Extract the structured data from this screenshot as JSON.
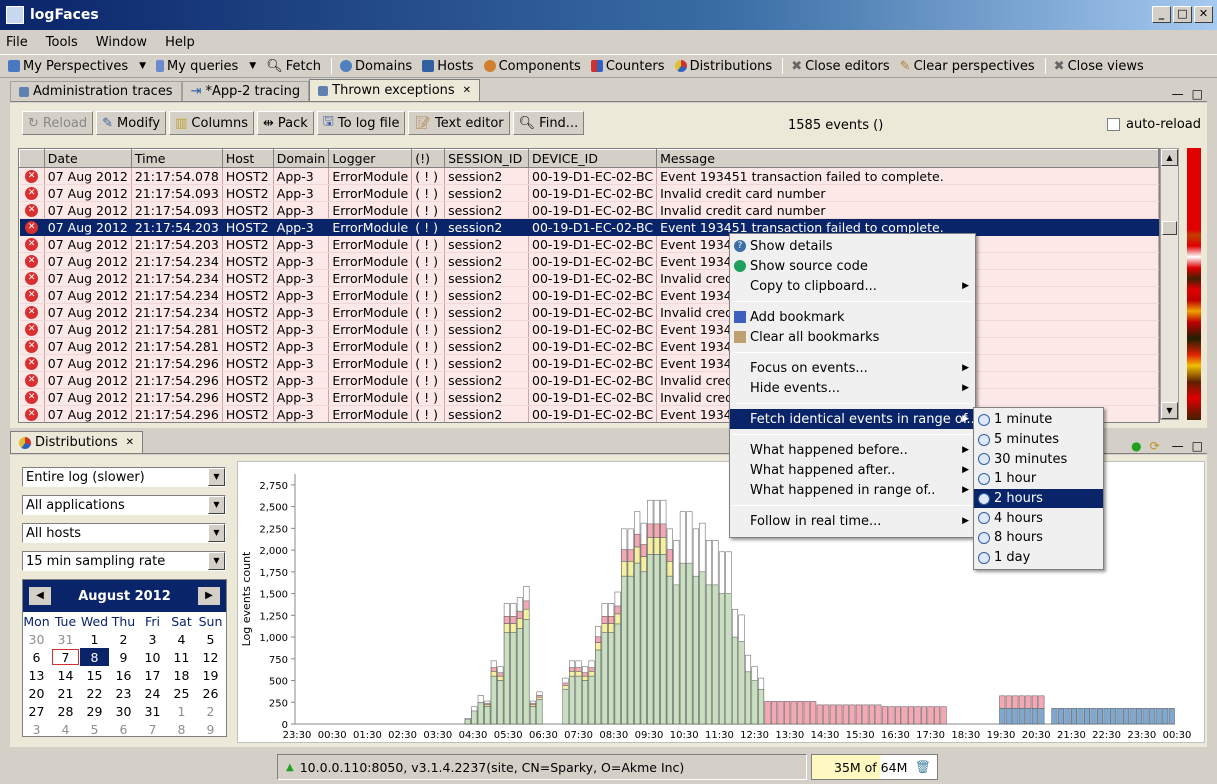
{
  "window": {
    "title": "logFaces"
  },
  "menu": [
    "File",
    "Tools",
    "Window",
    "Help"
  ],
  "toolbar": {
    "my_perspectives": "My Perspectives",
    "my_queries": "My queries",
    "fetch": "Fetch",
    "domains": "Domains",
    "hosts": "Hosts",
    "components": "Components",
    "counters": "Counters",
    "distributions": "Distributions",
    "close_editors": "Close editors",
    "clear_perspectives": "Clear perspectives",
    "close_views": "Close views"
  },
  "editor_tabs": [
    "Administration traces",
    "*App-2 tracing",
    "Thrown exceptions"
  ],
  "editor": {
    "buttons": {
      "reload": "Reload",
      "modify": "Modify",
      "columns": "Columns",
      "pack": "Pack",
      "to_log_file": "To log file",
      "text_editor": "Text editor",
      "find": "Find..."
    },
    "event_count": "1585 events ()",
    "auto_reload": "auto-reload",
    "columns": [
      "",
      "Date",
      "Time",
      "Host",
      "Domain",
      "Logger",
      "(!)",
      "SESSION_ID",
      "DEVICE_ID",
      "Message"
    ],
    "rows": [
      [
        "07 Aug 2012",
        "21:17:54.078",
        "HOST2",
        "App-3",
        "ErrorModule",
        "( ! )",
        "session2",
        "00-19-D1-EC-02-BC",
        "Event 193451 transaction failed to complete."
      ],
      [
        "07 Aug 2012",
        "21:17:54.093",
        "HOST2",
        "App-3",
        "ErrorModule",
        "( ! )",
        "session2",
        "00-19-D1-EC-02-BC",
        "Invalid credit card number"
      ],
      [
        "07 Aug 2012",
        "21:17:54.093",
        "HOST2",
        "App-3",
        "ErrorModule",
        "( ! )",
        "session2",
        "00-19-D1-EC-02-BC",
        "Invalid credit card number"
      ],
      [
        "07 Aug 2012",
        "21:17:54.203",
        "HOST2",
        "App-3",
        "ErrorModule",
        "( ! )",
        "session2",
        "00-19-D1-EC-02-BC",
        "Event 193451 transaction failed to complete."
      ],
      [
        "07 Aug 2012",
        "21:17:54.203",
        "HOST2",
        "App-3",
        "ErrorModule",
        "( ! )",
        "session2",
        "00-19-D1-EC-02-BC",
        "Event 1934"
      ],
      [
        "07 Aug 2012",
        "21:17:54.234",
        "HOST2",
        "App-3",
        "ErrorModule",
        "( ! )",
        "session2",
        "00-19-D1-EC-02-BC",
        "Event 1934"
      ],
      [
        "07 Aug 2012",
        "21:17:54.234",
        "HOST2",
        "App-3",
        "ErrorModule",
        "( ! )",
        "session2",
        "00-19-D1-EC-02-BC",
        "Invalid cred"
      ],
      [
        "07 Aug 2012",
        "21:17:54.234",
        "HOST2",
        "App-3",
        "ErrorModule",
        "( ! )",
        "session2",
        "00-19-D1-EC-02-BC",
        "Event 1934"
      ],
      [
        "07 Aug 2012",
        "21:17:54.234",
        "HOST2",
        "App-3",
        "ErrorModule",
        "( ! )",
        "session2",
        "00-19-D1-EC-02-BC",
        "Invalid cred"
      ],
      [
        "07 Aug 2012",
        "21:17:54.281",
        "HOST2",
        "App-3",
        "ErrorModule",
        "( ! )",
        "session2",
        "00-19-D1-EC-02-BC",
        "Event 1934"
      ],
      [
        "07 Aug 2012",
        "21:17:54.281",
        "HOST2",
        "App-3",
        "ErrorModule",
        "( ! )",
        "session2",
        "00-19-D1-EC-02-BC",
        "Event 1934"
      ],
      [
        "07 Aug 2012",
        "21:17:54.296",
        "HOST2",
        "App-3",
        "ErrorModule",
        "( ! )",
        "session2",
        "00-19-D1-EC-02-BC",
        "Event 1934"
      ],
      [
        "07 Aug 2012",
        "21:17:54.296",
        "HOST2",
        "App-3",
        "ErrorModule",
        "( ! )",
        "session2",
        "00-19-D1-EC-02-BC",
        "Invalid cred"
      ],
      [
        "07 Aug 2012",
        "21:17:54.296",
        "HOST2",
        "App-3",
        "ErrorModule",
        "( ! )",
        "session2",
        "00-19-D1-EC-02-BC",
        "Invalid cred"
      ],
      [
        "07 Aug 2012",
        "21:17:54.296",
        "HOST2",
        "App-3",
        "ErrorModule",
        "( ! )",
        "session2",
        "00-19-D1-EC-02-BC",
        "Event 1934"
      ]
    ],
    "selected_row": 3
  },
  "context_menu": {
    "items": [
      "Show details",
      "Show source code",
      "Copy to clipboard...",
      "Add bookmark",
      "Clear all bookmarks",
      "Focus on events...",
      "Hide events...",
      "Fetch identical events in range of...",
      "What happened before..",
      "What happened after..",
      "What happened in range of..",
      "Follow in real time..."
    ],
    "submenu": [
      "1 minute",
      "5 minutes",
      "30 minutes",
      "1 hour",
      "2 hours",
      "4 hours",
      "8 hours",
      "1 day"
    ],
    "highlighted": "Fetch identical events in range of...",
    "submenu_highlighted": "2 hours"
  },
  "distributions": {
    "tab": "Distributions",
    "selects": [
      "Entire log (slower)",
      "All applications",
      "All hosts",
      "15 min sampling rate"
    ],
    "calendar": {
      "month": "August 2012",
      "days": [
        "Mon",
        "Tue",
        "Wed",
        "Thu",
        "Fri",
        "Sat",
        "Sun"
      ],
      "weeks": [
        [
          "30",
          "31",
          "1",
          "2",
          "3",
          "4",
          "5"
        ],
        [
          "6",
          "7",
          "8",
          "9",
          "10",
          "11",
          "12"
        ],
        [
          "13",
          "14",
          "15",
          "16",
          "17",
          "18",
          "19"
        ],
        [
          "20",
          "21",
          "22",
          "23",
          "24",
          "25",
          "26"
        ],
        [
          "27",
          "28",
          "29",
          "30",
          "31",
          "1",
          "2"
        ],
        [
          "3",
          "4",
          "5",
          "6",
          "7",
          "8",
          "9"
        ]
      ],
      "selected": "8",
      "today": "7"
    }
  },
  "chart_data": {
    "type": "bar",
    "ylabel": "Log events count",
    "yticks": [
      "0",
      "250",
      "500",
      "750",
      "1,000",
      "1,250",
      "1,500",
      "1,750",
      "2,000",
      "2,250",
      "2,500",
      "2,750"
    ],
    "ylim": [
      0,
      2875
    ],
    "xticks": [
      "23:30",
      "00:30",
      "01:30",
      "02:30",
      "03:30",
      "04:30",
      "05:30",
      "06:30",
      "07:30",
      "08:30",
      "09:30",
      "10:30",
      "11:30",
      "12:30",
      "13:30",
      "14:30",
      "15:30",
      "16:30",
      "17:30",
      "18:30",
      "19:30",
      "20:30",
      "21:30",
      "22:30",
      "23:30",
      "00:30"
    ],
    "series_colors": {
      "green": "#c8e0c0",
      "blue": "#7fa8d0",
      "pink": "#f4a8b4",
      "yellow": "#f4f0a0",
      "white": "#ffffff"
    },
    "series": [
      {
        "values": [
          0,
          0,
          0,
          0,
          0,
          0,
          0,
          0,
          0,
          0,
          0,
          0,
          0,
          0,
          0,
          0,
          0,
          0,
          0,
          0,
          0,
          0,
          0,
          0,
          0,
          0,
          50,
          150,
          250,
          200,
          550,
          500,
          1050,
          1050,
          1100,
          1200,
          200,
          280,
          0,
          0,
          0,
          400,
          550,
          550,
          500,
          550,
          850,
          1050,
          1050,
          1150,
          1700,
          1700,
          1850,
          1750,
          1950,
          1950,
          1950,
          1700,
          1600,
          1850,
          1850,
          1700,
          1750,
          1600,
          1600,
          1500,
          1500,
          1000,
          950,
          600,
          500,
          400,
          0,
          0,
          0,
          0,
          0,
          0,
          0,
          0,
          0,
          0,
          0,
          0,
          0,
          0,
          0,
          0,
          0,
          0,
          0,
          0,
          0,
          0,
          0,
          0,
          0,
          0,
          0,
          0,
          0,
          0,
          0,
          0,
          0,
          0,
          0,
          0,
          0,
          0,
          0,
          0,
          0,
          0,
          0,
          0,
          0,
          0,
          0,
          0,
          0,
          0,
          0,
          0,
          0,
          0,
          0,
          0,
          0,
          0,
          0,
          0,
          0,
          0,
          0
        ]
      },
      {
        "values": [
          0,
          0,
          0,
          0,
          0,
          0,
          0,
          0,
          0,
          0,
          0,
          0,
          0,
          0,
          0,
          0,
          0,
          0,
          0,
          0,
          0,
          0,
          0,
          0,
          0,
          0,
          0,
          0,
          0,
          0,
          0,
          0,
          0,
          0,
          0,
          0,
          0,
          0,
          0,
          0,
          0,
          0,
          0,
          0,
          0,
          0,
          0,
          0,
          0,
          0,
          0,
          0,
          0,
          0,
          0,
          0,
          0,
          0,
          0,
          0,
          0,
          0,
          0,
          0,
          0,
          0,
          0,
          0,
          0,
          0,
          0,
          0,
          0,
          0,
          0,
          0,
          0,
          0,
          0,
          0,
          0,
          0,
          0,
          0,
          0,
          0,
          0,
          0,
          0,
          0,
          0,
          0,
          0,
          0,
          0,
          0,
          0,
          0,
          0,
          0,
          0,
          0,
          0,
          0,
          0,
          0,
          0,
          0,
          180,
          180,
          180,
          180,
          180,
          180,
          180,
          0,
          180,
          180,
          180,
          180,
          180,
          180,
          180,
          180,
          180,
          180,
          180,
          180,
          180,
          180,
          180,
          180,
          180,
          180,
          180,
          180
        ]
      }
    ]
  },
  "status": {
    "connection": "10.0.0.110:8050, v3.1.4.2237(site, CN=Sparky, O=Akme Inc)",
    "memory": "35M of 64M"
  }
}
